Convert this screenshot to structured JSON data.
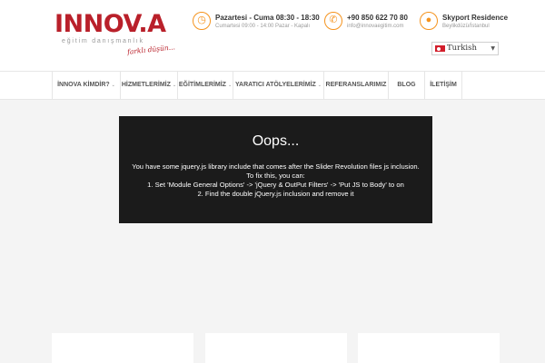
{
  "logo": {
    "word": "INNOV.A",
    "subtitle": "eğitim danışmanlık",
    "slogan": "farklı düşün..."
  },
  "header_info": [
    {
      "icon": "clock-icon",
      "title": "Pazartesi - Cuma 08:30 - 18:30",
      "detail": "Cumartesi 09:00 - 14:00 Pazar - Kapalı"
    },
    {
      "icon": "phone-icon",
      "title": "+90 850 622 70 80",
      "detail": "info@innovaegitim.com"
    },
    {
      "icon": "location-pin-icon",
      "title": "Skyport Residence",
      "detail": "Beylikdüzü/İstanbul"
    }
  ],
  "language": {
    "selected": "Turkish"
  },
  "nav": {
    "items": [
      {
        "label": "İNNOVA KİMDİR?",
        "has_dropdown": true
      },
      {
        "label": "HİZMETLERİMİZ",
        "has_dropdown": true
      },
      {
        "label": "EĞİTİMLERİMİZ",
        "has_dropdown": true
      },
      {
        "label": "YARATICI ATÖLYELERİMİZ",
        "has_dropdown": true
      },
      {
        "label": "REFERANSLARIMIZ",
        "has_dropdown": false
      },
      {
        "label": "BLOG",
        "has_dropdown": false
      },
      {
        "label": "İLETİŞİM",
        "has_dropdown": false
      }
    ]
  },
  "error": {
    "title": "Oops...",
    "lines": [
      "You have some jquery.js library include that comes after the Slider Revolution files js inclusion.",
      "To fix this, you can:",
      "1. Set 'Module General Options' -> 'jQuery & OutPut Filters' -> 'Put JS to Body' to on",
      "2. Find the double jQuery.js inclusion and remove it"
    ]
  },
  "colors": {
    "brand_red": "#b9202a",
    "accent_orange": "#f5931e",
    "error_bg": "#1b1b1b"
  }
}
